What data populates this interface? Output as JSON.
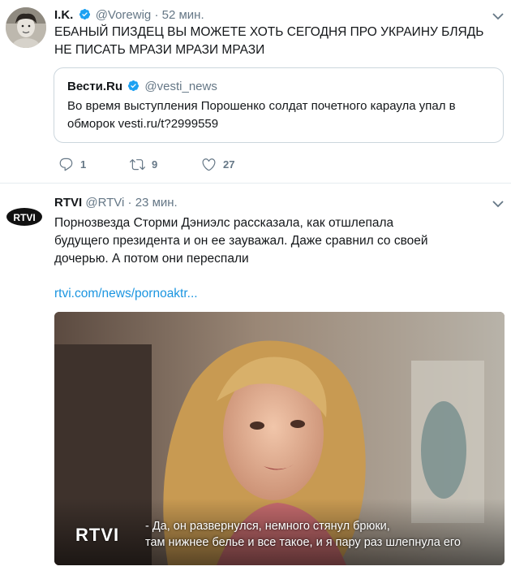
{
  "tweets": [
    {
      "name": "I.K.",
      "handle": "@Vorewig",
      "time_sep": "·",
      "time": "52 мин.",
      "text": "ЕБАНЫЙ ПИЗДЕЦ ВЫ МОЖЕТЕ ХОТЬ СЕГОДНЯ ПРО УКРАИНУ БЛЯДЬ НЕ ПИСАТЬ МРАЗИ МРАЗИ МРАЗИ",
      "quote": {
        "name": "Вести.Ru",
        "handle": "@vesti_news",
        "text": "Во время выступления Порошенко солдат почетного караула упал в обморок vesti.ru/t?2999559"
      },
      "actions": {
        "replies": "1",
        "retweets": "9",
        "likes": "27"
      }
    },
    {
      "name": "RTVI",
      "handle": "@RTVi",
      "time_sep": "·",
      "time": "23 мин.",
      "avatar_text": "RTVI",
      "text": "Порнозвезда Сторми Дэниэлс рассказала, как отшлепала будущего президента и он ее зауважал. Даже сравнил со своей дочерью. А потом они переспали",
      "link": "rtvi.com/news/pornoaktr...",
      "media": {
        "badge": "RTVI",
        "caption_line1": "- Да, он развернулся, немного стянул брюки,",
        "caption_line2": "там нижнее белье и все такое, и я пару раз шлепнула его"
      }
    }
  ],
  "colors": {
    "link": "#1b95e0",
    "verified": "#1da1f2",
    "muted": "#657786",
    "border": "#e6ecf0"
  }
}
